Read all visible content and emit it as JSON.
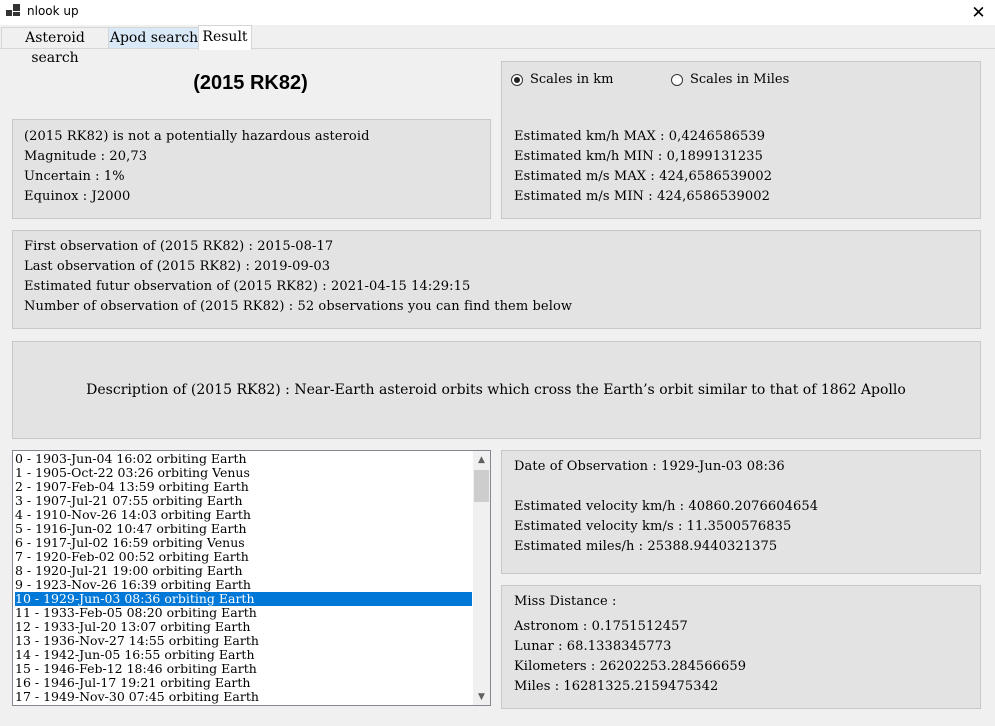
{
  "window": {
    "title": "nlook up",
    "close_glyph": "✕"
  },
  "tabs": [
    {
      "label": "Asteroid search"
    },
    {
      "label": "Apod search"
    },
    {
      "label": "Result"
    }
  ],
  "summary": {
    "object_name": "(2015 RK82)",
    "hazard": "(2015 RK82) is not a potentially hazardous asteroid",
    "magnitude": "Magnitude : 20,73",
    "uncertain": "Uncertain : 1%",
    "equinox": "Equinox : J2000"
  },
  "scales": {
    "options": [
      "Scales in km",
      "Scales in Miles"
    ],
    "selected": "Scales in km",
    "kmh_max": "Estimated km/h MAX : 0,4246586539",
    "kmh_min": "Estimated km/h MIN : 0,1899131235",
    "ms_max": "Estimated m/s MAX : 424,6586539002",
    "ms_min": "Estimated m/s MIN : 424,6586539002"
  },
  "observations": {
    "first": "First observation of (2015 RK82) : 2015-08-17",
    "last": "Last observation of (2015 RK82) : 2019-09-03",
    "future": "Estimated futur observation of (2015 RK82) : 2021-04-15 14:29:15",
    "count": "Number of observation of (2015 RK82) : 52 observations you can find them below"
  },
  "description": "Description of (2015 RK82) : Near-Earth asteroid orbits which cross the Earth’s orbit similar to that of 1862 Apollo",
  "approach_list": {
    "selected_index": 10,
    "items": [
      "0 - 1903-Jun-04 16:02 orbiting Earth",
      "1 - 1905-Oct-22 03:26 orbiting Venus",
      "2 - 1907-Feb-04 13:59 orbiting Earth",
      "3 - 1907-Jul-21 07:55 orbiting Earth",
      "4 - 1910-Nov-26 14:03 orbiting Earth",
      "5 - 1916-Jun-02 10:47 orbiting Earth",
      "6 - 1917-Jul-02 16:59 orbiting Venus",
      "7 - 1920-Feb-02 00:52 orbiting Earth",
      "8 - 1920-Jul-21 19:00 orbiting Earth",
      "9 - 1923-Nov-26 16:39 orbiting Earth",
      "10 - 1929-Jun-03 08:36 orbiting Earth",
      "11 - 1933-Feb-05 08:20 orbiting Earth",
      "12 - 1933-Jul-20 13:07 orbiting Earth",
      "13 - 1936-Nov-27 14:55 orbiting Earth",
      "14 - 1942-Jun-05 16:55 orbiting Earth",
      "15 - 1946-Feb-12 18:46 orbiting Earth",
      "16 - 1946-Jul-17 19:21 orbiting Earth",
      "17 - 1949-Nov-30 07:45 orbiting Earth"
    ],
    "scroll_up_glyph": "▲",
    "scroll_down_glyph": "▼"
  },
  "detail": {
    "date": "Date of Observation : 1929-Jun-03 08:36",
    "vel_kmh": "Estimated velocity km/h : 40860.2076604654",
    "vel_kms": "Estimated velocity km/s : 11.3500576835",
    "vel_mih": "Estimated miles/h : 25388.9440321375"
  },
  "miss": {
    "heading": "Miss Distance :",
    "astronom": "Astronom : 0.1751512457",
    "lunar": "Lunar : 68.1338345773",
    "km": "Kilometers : 26202253.284566659",
    "miles": "Miles : 16281325.2159475342"
  }
}
